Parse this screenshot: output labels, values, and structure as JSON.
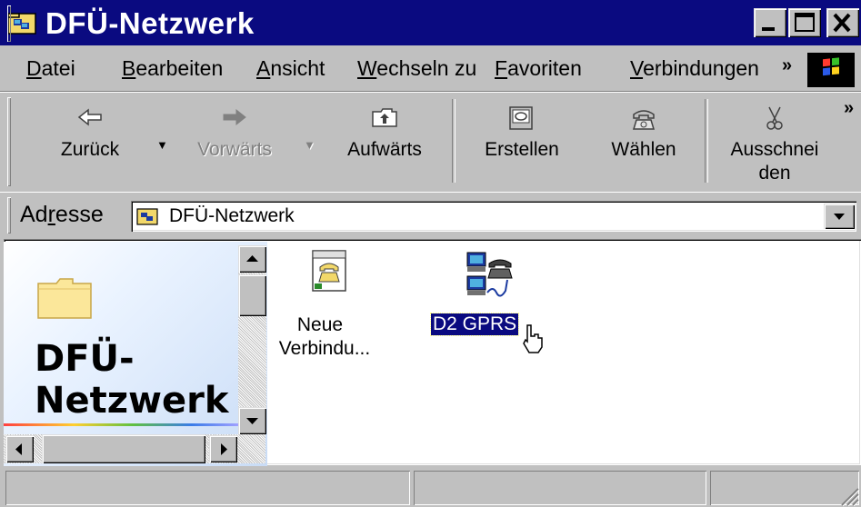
{
  "window": {
    "title": "DFÜ-Netzwerk",
    "title_bar_color": "#0a0a80",
    "controls": [
      "minimize-icon",
      "maximize-icon",
      "close-icon"
    ]
  },
  "menu": {
    "items": [
      {
        "label": "Datei",
        "accel": "D"
      },
      {
        "label": "Bearbeiten",
        "accel": "B"
      },
      {
        "label": "Ansicht",
        "accel": "A"
      },
      {
        "label": "Wechseln zu",
        "accel": "W"
      },
      {
        "label": "Favoriten",
        "accel": "F"
      },
      {
        "label": "Verbindungen",
        "accel": "V"
      }
    ],
    "overflow": "»"
  },
  "toolbar": {
    "back_label": "Zurück",
    "forward_label": "Vorwärts",
    "up_label": "Aufwärts",
    "create_label": "Erstellen",
    "dial_label": "Wählen",
    "cut_label_line1": "Ausschnei",
    "cut_label_line2": "den",
    "overflow": "»"
  },
  "address": {
    "label": "Adresse",
    "accel": "r",
    "value": "DFÜ-Netzwerk"
  },
  "left_panel": {
    "title_line1": "DFÜ-",
    "title_line2": "Netzwerk"
  },
  "items": [
    {
      "label_line1": "Neue",
      "label_line2": "Verbindu...",
      "icon": "new-connection-icon",
      "selected": false
    },
    {
      "label_line1": "D2 GPRS",
      "icon": "dialup-connection-icon",
      "selected": true
    }
  ],
  "statusbar": {
    "panes": [
      "",
      "",
      ""
    ]
  }
}
